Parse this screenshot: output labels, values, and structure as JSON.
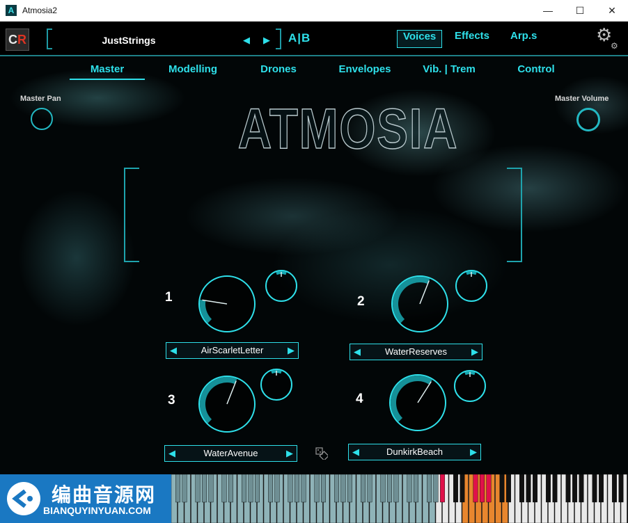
{
  "window": {
    "title": "Atmosia2",
    "app_icon": "A",
    "minimize": "—",
    "maximize": "☐",
    "close": "✕"
  },
  "toolbar": {
    "logo": "C",
    "logo_accent": "R",
    "preset": "JustStrings",
    "prev": "◀",
    "next": "▶",
    "ab": "A|B",
    "tabs": [
      {
        "label": "Voices",
        "active": true
      },
      {
        "label": "Effects"
      },
      {
        "label": "Arp.s"
      }
    ],
    "settings_icon": "gear-icon"
  },
  "subtabs": [
    {
      "label": "Master",
      "active": true
    },
    {
      "label": "Modelling"
    },
    {
      "label": "Drones"
    },
    {
      "label": "Envelopes"
    },
    {
      "label": "Vib. | Trem"
    },
    {
      "label": "Control"
    }
  ],
  "master": {
    "pan_label": "Master Pan",
    "volume_label": "Master Volume"
  },
  "logo_text": "ATMOSIA",
  "layers": [
    {
      "number": "1",
      "sample": "AirScarletLetter",
      "level": 0.2
    },
    {
      "number": "2",
      "sample": "WaterReserves",
      "level": 0.58
    },
    {
      "number": "3",
      "sample": "WaterAvenue",
      "level": 0.58
    },
    {
      "number": "4",
      "sample": "DunkirkBeach",
      "level": 0.62
    }
  ],
  "arrows": {
    "left": "◀",
    "right": "▶"
  },
  "watermark": {
    "title": "编曲音源网",
    "url": "BIANQUYINYUAN.COM"
  },
  "colors": {
    "accent": "#2ee0ea",
    "active_key": "#e0114a",
    "orange_key": "#e8862e"
  }
}
